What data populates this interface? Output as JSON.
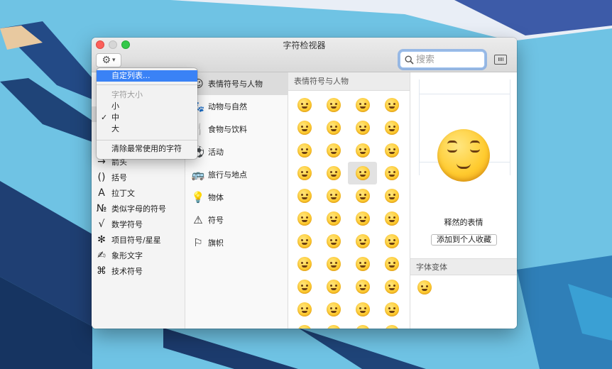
{
  "window": {
    "title": "字符检视器",
    "search": {
      "placeholder": "搜索",
      "value": ""
    }
  },
  "gear_menu": {
    "items": [
      {
        "label": "自定列表...",
        "highlighted": true
      },
      {
        "label": "字符大小",
        "disabled": true
      },
      {
        "label": "小"
      },
      {
        "label": "中",
        "checked": true,
        "check_mark": "✓"
      },
      {
        "label": "大"
      },
      {
        "label": "清除最常使用的字符"
      }
    ]
  },
  "sidebar": {
    "items": [
      {
        "icon": "arrow-right-icon",
        "glyph": "→",
        "label": "箭头"
      },
      {
        "icon": "parentheses-icon",
        "glyph": "()",
        "label": "括号"
      },
      {
        "icon": "latin-letter-icon",
        "glyph": "A",
        "label": "拉丁文"
      },
      {
        "icon": "numero-sign-icon",
        "glyph": "№",
        "label": "类似字母的符号"
      },
      {
        "icon": "square-root-icon",
        "glyph": "√",
        "label": "数学符号"
      },
      {
        "icon": "asterisk-icon",
        "glyph": "✻",
        "label": "项目符号/星星"
      },
      {
        "icon": "pictograph-icon",
        "glyph": "✍",
        "label": "象形文字"
      },
      {
        "icon": "command-key-icon",
        "glyph": "⌘",
        "label": "技术符号"
      }
    ]
  },
  "categories": {
    "items": [
      {
        "icon": "smiley-icon",
        "glyph": "☺",
        "label": "表情符号与人物",
        "selected": true
      },
      {
        "icon": "animal-icon",
        "glyph": "🐾",
        "label": "动物与自然"
      },
      {
        "icon": "food-icon",
        "glyph": "🍴",
        "label": "食物与饮料"
      },
      {
        "icon": "ball-icon",
        "glyph": "⚽",
        "label": "活动"
      },
      {
        "icon": "travel-icon",
        "glyph": "🚌",
        "label": "旅行与地点"
      },
      {
        "icon": "lightbulb-icon",
        "glyph": "💡",
        "label": "物体"
      },
      {
        "icon": "symbols-icon",
        "glyph": "⚠",
        "label": "符号"
      },
      {
        "icon": "flag-icon",
        "glyph": "⚐",
        "label": "旗帜"
      }
    ]
  },
  "emoji_panel": {
    "header": "表情符号与人物",
    "count": 44,
    "selected_index": 14
  },
  "detail": {
    "name": "释然的表情",
    "favorite_button": "添加到个人收藏",
    "variants_header": "字体变体"
  }
}
